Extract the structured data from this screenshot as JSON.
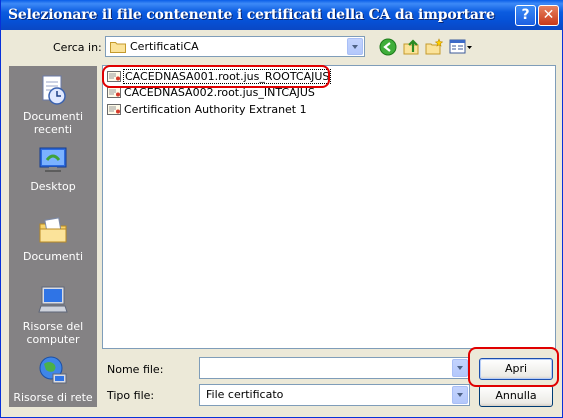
{
  "window": {
    "title": "Selezionare il file contenente i certificati della CA da importare",
    "help_glyph": "?",
    "close_glyph": "✕"
  },
  "lookin": {
    "label": "Cerca in:",
    "value": "CertificatiCA"
  },
  "toolbar": {
    "icons": [
      "back-icon",
      "up-folder-icon",
      "new-folder-icon",
      "view-menu-icon"
    ]
  },
  "places": [
    {
      "label": "Documenti recenti",
      "icon": "recent-documents-icon"
    },
    {
      "label": "Desktop",
      "icon": "desktop-icon"
    },
    {
      "label": "Documenti",
      "icon": "my-documents-icon"
    },
    {
      "label": "Risorse del computer",
      "icon": "my-computer-icon"
    },
    {
      "label": "Risorse di rete",
      "icon": "network-places-icon"
    }
  ],
  "files": [
    {
      "name": "CACEDNASA001.root.jus_ROOTCAJUS",
      "icon": "certificate-icon",
      "selected": true
    },
    {
      "name": "CACEDNASA002.root.jus_INTCAJUS",
      "icon": "certificate-icon",
      "selected": false
    },
    {
      "name": "Certification Authority Extranet 1",
      "icon": "certificate-icon",
      "selected": false
    }
  ],
  "filename": {
    "label": "Nome file:",
    "value": ""
  },
  "filetype": {
    "label": "Tipo file:",
    "value": "File certificato"
  },
  "buttons": {
    "open": "Apri",
    "cancel": "Annulla"
  },
  "colors": {
    "titlebar": "#0a5ee8",
    "dialog_bg": "#ece9d8",
    "places_bg": "#848284",
    "annotation": "#e00000"
  }
}
